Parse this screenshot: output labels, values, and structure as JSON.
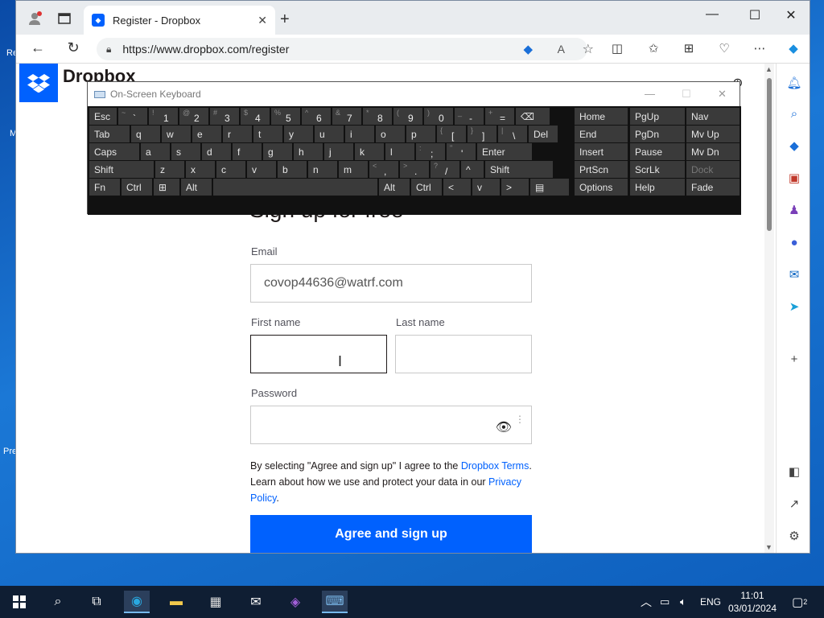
{
  "browser": {
    "tab_title": "Register - Dropbox",
    "url": "https://www.dropbox.com/register"
  },
  "page": {
    "brand": "Dropbox",
    "heading": "Sign up for free",
    "email_label": "Email",
    "email_value": "covop44636@watrf.com",
    "first_name_label": "First name",
    "first_name_value": "",
    "last_name_label": "Last name",
    "last_name_value": "",
    "password_label": "Password",
    "password_value": "",
    "legal_prefix": "By selecting \"Agree and sign up\" I agree to the ",
    "legal_link1": "Dropbox Terms",
    "legal_middle": ". Learn about how we use and protect your data in our ",
    "legal_link2": "Privacy Policy",
    "legal_suffix": ".",
    "cta": "Agree and sign up"
  },
  "osk": {
    "title": "On-Screen Keyboard",
    "rows": [
      [
        [
          "Esc",
          ""
        ],
        [
          "`",
          "~"
        ],
        [
          "1",
          "!"
        ],
        [
          "2",
          "@"
        ],
        [
          "3",
          "#"
        ],
        [
          "4",
          "$"
        ],
        [
          "5",
          "%"
        ],
        [
          "6",
          "^"
        ],
        [
          "7",
          "&"
        ],
        [
          "8",
          "*"
        ],
        [
          "9",
          "("
        ],
        [
          "0",
          ")"
        ],
        [
          "-",
          "_"
        ],
        [
          "=",
          "+"
        ],
        [
          "⌫",
          ""
        ]
      ],
      [
        [
          "Tab",
          ""
        ],
        [
          "q",
          ""
        ],
        [
          "w",
          ""
        ],
        [
          "e",
          ""
        ],
        [
          "r",
          ""
        ],
        [
          "t",
          ""
        ],
        [
          "y",
          ""
        ],
        [
          "u",
          ""
        ],
        [
          "i",
          ""
        ],
        [
          "o",
          ""
        ],
        [
          "p",
          ""
        ],
        [
          "[",
          "{"
        ],
        [
          "]",
          "}"
        ],
        [
          "\\",
          "|"
        ],
        [
          "Del",
          ""
        ]
      ],
      [
        [
          "Caps",
          ""
        ],
        [
          "a",
          ""
        ],
        [
          "s",
          ""
        ],
        [
          "d",
          ""
        ],
        [
          "f",
          ""
        ],
        [
          "g",
          ""
        ],
        [
          "h",
          ""
        ],
        [
          "j",
          ""
        ],
        [
          "k",
          ""
        ],
        [
          "l",
          ""
        ],
        [
          ";",
          ":"
        ],
        [
          "'",
          "\""
        ],
        [
          "Enter",
          ""
        ]
      ],
      [
        [
          "Shift",
          ""
        ],
        [
          "z",
          ""
        ],
        [
          "x",
          ""
        ],
        [
          "c",
          ""
        ],
        [
          "v",
          ""
        ],
        [
          "b",
          ""
        ],
        [
          "n",
          ""
        ],
        [
          "m",
          ""
        ],
        [
          ",",
          "<"
        ],
        [
          ".",
          ">"
        ],
        [
          "/",
          "?"
        ],
        [
          "^",
          ""
        ],
        [
          "Shift",
          ""
        ]
      ],
      [
        [
          "Fn",
          ""
        ],
        [
          "Ctrl",
          ""
        ],
        [
          "⊞",
          ""
        ],
        [
          "Alt",
          ""
        ],
        [
          "",
          ""
        ],
        [
          "Alt",
          ""
        ],
        [
          "Ctrl",
          ""
        ],
        [
          "<",
          ""
        ],
        [
          "v",
          ""
        ],
        [
          ">",
          ""
        ],
        [
          "▤",
          ""
        ]
      ]
    ],
    "right_cols": [
      [
        "Home",
        "PgUp",
        "Nav"
      ],
      [
        "End",
        "PgDn",
        "Mv Up"
      ],
      [
        "Insert",
        "Pause",
        "Mv Dn"
      ],
      [
        "PrtScn",
        "ScrLk",
        "Dock"
      ],
      [
        "Options",
        "Help",
        "Fade"
      ]
    ]
  },
  "taskbar": {
    "language": "ENG",
    "time": "11:01",
    "date": "03/01/2024",
    "notifications": "2"
  },
  "desktop": {
    "frag1": "Re",
    "frag2": "Pre",
    "frag3": "M"
  },
  "colors": {
    "accent": "#0061fe",
    "osk_bg": "#111111",
    "taskbar": "#0f1e33"
  }
}
